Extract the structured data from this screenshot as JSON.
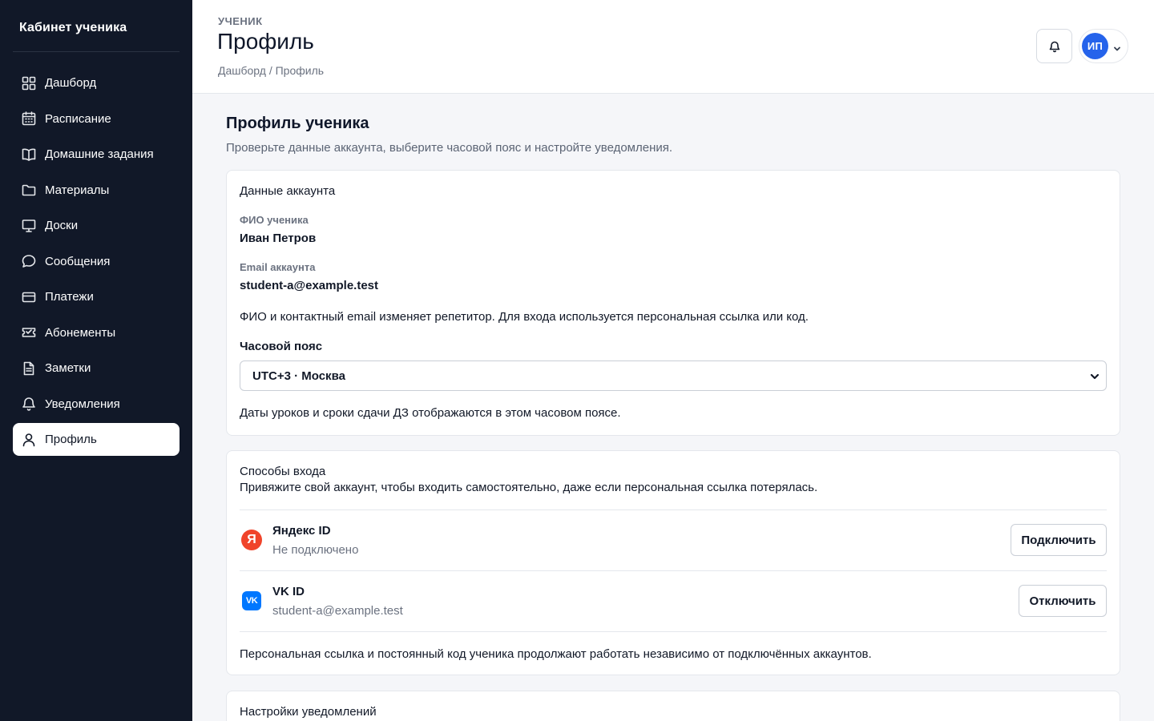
{
  "sidebar": {
    "brand": "Кабинет ученика",
    "items": [
      {
        "label": "Дашборд",
        "icon": "dashboard-icon"
      },
      {
        "label": "Расписание",
        "icon": "calendar-icon"
      },
      {
        "label": "Домашние задания",
        "icon": "book-icon"
      },
      {
        "label": "Материалы",
        "icon": "folder-icon"
      },
      {
        "label": "Доски",
        "icon": "board-icon"
      },
      {
        "label": "Сообщения",
        "icon": "message-icon"
      },
      {
        "label": "Платежи",
        "icon": "credit-card-icon"
      },
      {
        "label": "Абонементы",
        "icon": "ticket-icon"
      },
      {
        "label": "Заметки",
        "icon": "notes-icon"
      },
      {
        "label": "Уведомления",
        "icon": "bell-icon"
      },
      {
        "label": "Профиль",
        "icon": "user-icon",
        "active": true
      }
    ]
  },
  "header": {
    "eyebrow": "УЧЕНИК",
    "title": "Профиль",
    "breadcrumb": "Дашборд / Профиль",
    "avatar_initials": "ИП"
  },
  "main": {
    "title": "Профиль ученика",
    "subtitle": "Проверьте данные аккаунта, выберите часовой пояс и настройте уведомления."
  },
  "account": {
    "title": "Данные аккаунта",
    "name_label": "ФИО ученика",
    "name_value": "Иван Петров",
    "email_label": "Email аккаунта",
    "email_value": "student-a@example.test",
    "note": "ФИО и контактный email изменяет репетитор. Для входа используется персональная ссылка или код.",
    "timezone_label": "Часовой пояс",
    "timezone_value": "UTC+3 · Москва",
    "timezone_hint": "Даты уроков и сроки сдачи ДЗ отображаются в этом часовом поясе."
  },
  "login": {
    "title": "Способы входа",
    "subtitle": "Привяжите свой аккаунт, чтобы входить самостоятельно, даже если персональная ссылка потерялась.",
    "providers": [
      {
        "name": "Яндекс ID",
        "status": "Не подключено",
        "button": "Подключить",
        "logo_text": "Я",
        "color": "#f0442b"
      },
      {
        "name": "VK ID",
        "status": "student-a@example.test",
        "button": "Отключить",
        "logo_text": "VK",
        "color": "#0077ff"
      }
    ],
    "footer": "Персональная ссылка и постоянный код ученика продолжают работать независимо от подключённых аккаунтов."
  },
  "notifications": {
    "title": "Настройки уведомлений"
  },
  "colors": {
    "sidebar_bg": "#111828",
    "accent": "#2563eb",
    "page_bg": "#f5f6f9"
  }
}
